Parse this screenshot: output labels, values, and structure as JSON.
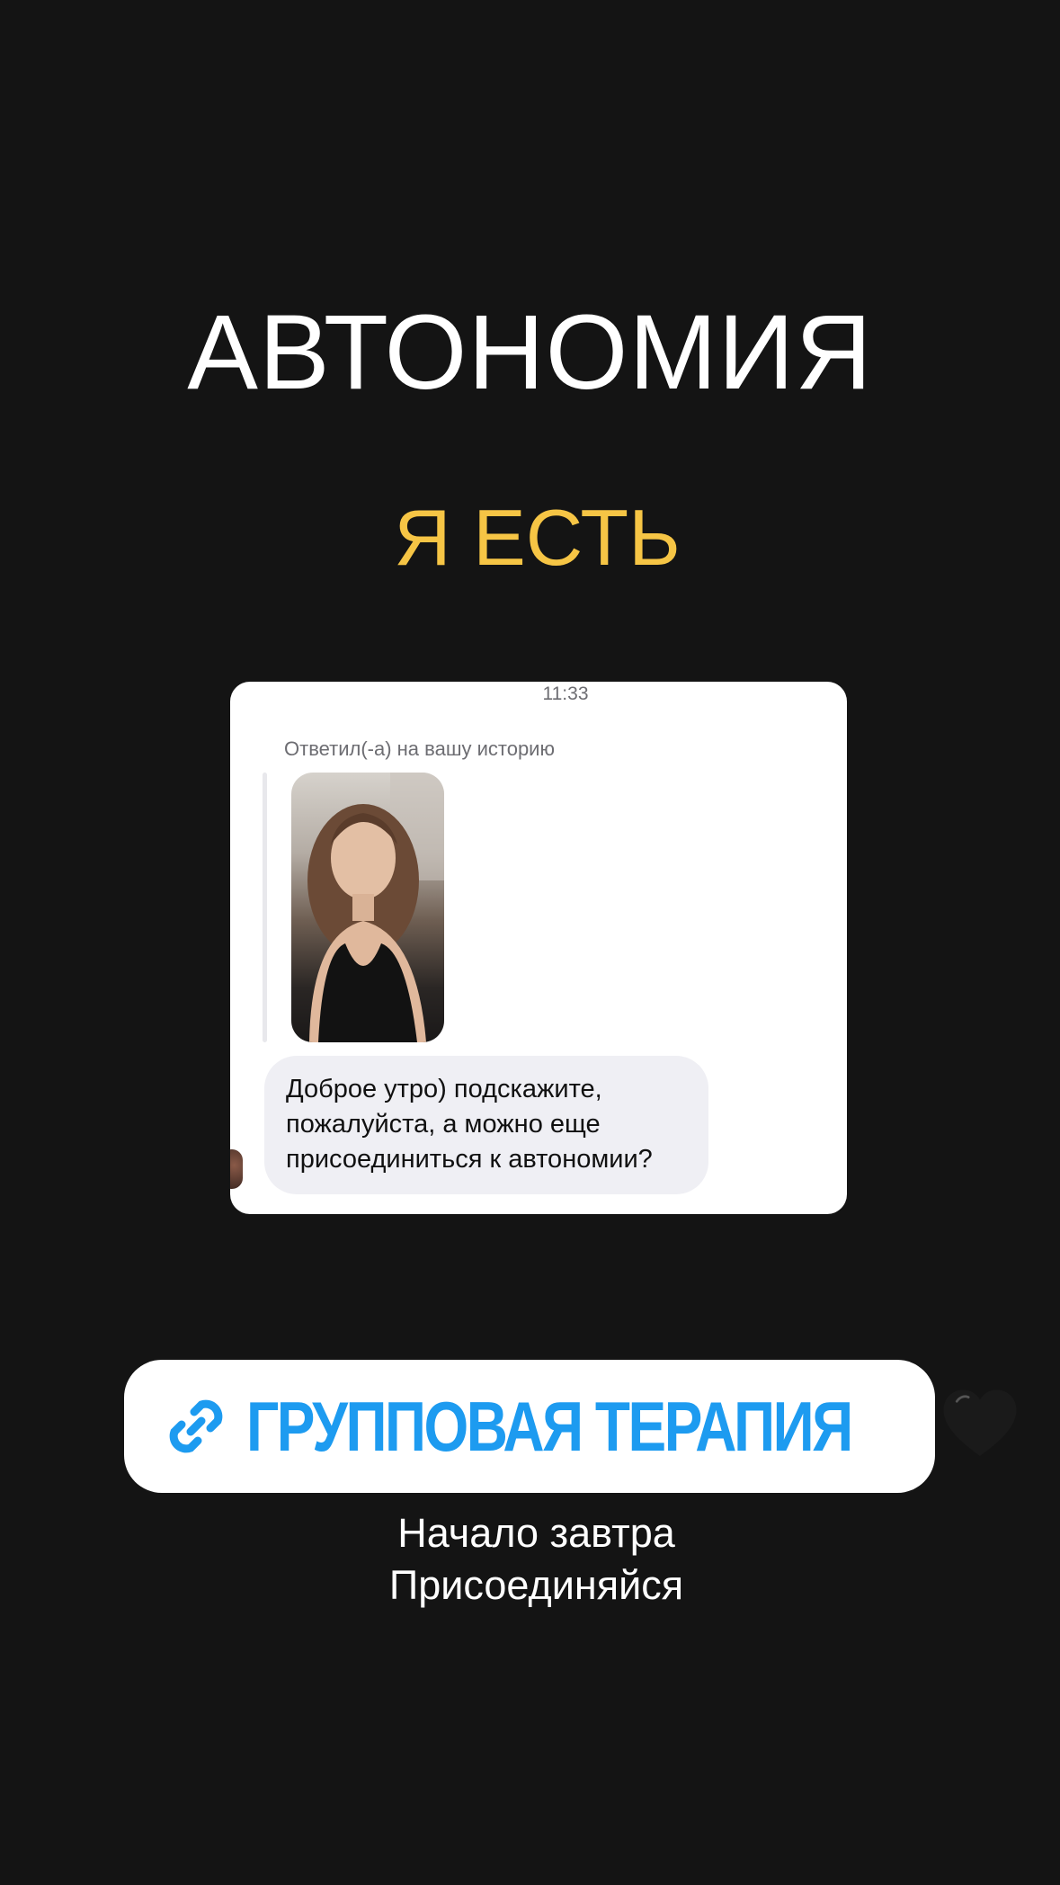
{
  "story": {
    "title": "АВТОНОМИЯ",
    "subtitle": "Я ЕСТЬ",
    "colors": {
      "background": "#141414",
      "subtitle": "#f6c545",
      "link": "#1d9bf0"
    }
  },
  "screenshot_card": {
    "time": "11:33",
    "reply_label": "Ответил(-а) на вашу историю",
    "message_lines": [
      "Доброе утро) подскажите,",
      "пожалуйста, а можно еще",
      "присоединиться к автономии?"
    ],
    "story_thumbnail_icon": "story-photo-thumbnail",
    "avatar_icon": "sender-avatar"
  },
  "link_sticker": {
    "icon": "link-icon",
    "label": "ГРУППОВАЯ ТЕРАПИЯ",
    "emoji": "black-heart-icon"
  },
  "caption": {
    "line1": "Начало завтра",
    "line2": "Присоединяйся"
  }
}
